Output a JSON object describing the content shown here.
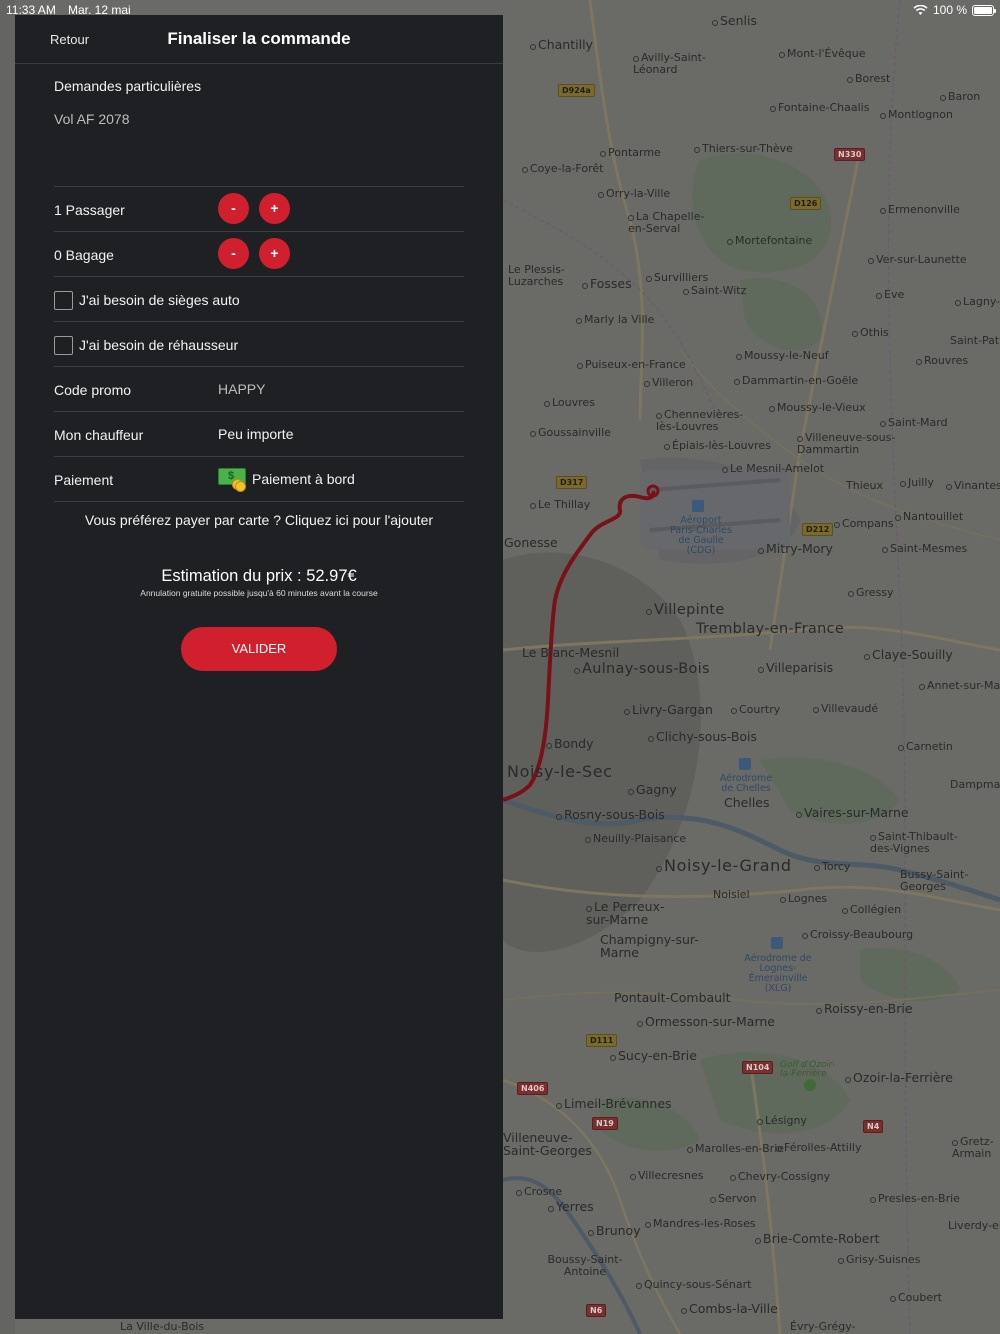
{
  "status_bar": {
    "time": "11:33 AM",
    "date": "Mar. 12 mai",
    "battery": "100 %"
  },
  "nav": {
    "back_label": "Retour",
    "title": "Finaliser la commande"
  },
  "special_requests": {
    "label": "Demandes particulières",
    "value": "Vol AF 2078"
  },
  "passengers": {
    "label": "1 Passager",
    "minus": "-",
    "plus": "+"
  },
  "luggage": {
    "label": "0 Bagage",
    "minus": "-",
    "plus": "+"
  },
  "child_seat": {
    "label": "J'ai besoin de sièges auto",
    "checked": false
  },
  "booster": {
    "label": "J'ai besoin de réhausseur",
    "checked": false
  },
  "promo": {
    "label": "Code promo",
    "value": "HAPPY"
  },
  "driver": {
    "label": "Mon chauffeur",
    "value": "Peu importe"
  },
  "payment": {
    "label": "Paiement",
    "value": "Paiement à bord",
    "icon": "cash-icon"
  },
  "card_link": "Vous préférez payer par carte ? Cliquez ici pour l'ajouter",
  "price": {
    "estimate": "Estimation du prix : 52.97€",
    "note": "Annulation gratuite possible jusqu'à 60 minutes avant la course"
  },
  "validate_label": "VALIDER",
  "colors": {
    "accent": "#d0202d",
    "panel": "#1f2023",
    "route": "#7a1018"
  },
  "map": {
    "places": [
      "Senlis",
      "Mont-l'Évêque",
      "Chantilly",
      "Avilly-Saint-Léonard",
      "Borest",
      "Baron",
      "Fontaine-Chaalis",
      "Montlognon",
      "Pontarme",
      "Thiers-sur-Thève",
      "Coye-la-Forêt",
      "Orry-la-Ville",
      "Ermenonville",
      "La Chapelle-en-Serval",
      "Mortefontaine",
      "Ver-sur-Launette",
      "Le Plessis-Luzarches",
      "Fosses",
      "Survilliers",
      "Saint-Witz",
      "Eve",
      "Lagny-",
      "Marly la Ville",
      "Othis",
      "Saint-Pat",
      "Moussy-le-Neuf",
      "Rouvres",
      "Puiseux-en-France",
      "Villeron",
      "Dammartin-en-Goële",
      "Louvres",
      "Moussy-le-Vieux",
      "Chennevières-lès-Louvres",
      "Saint-Mard",
      "Goussainville",
      "Épiais-lès-Louvres",
      "Villeneuve-sous-Dammartin",
      "Le Mesnil-Amelot",
      "Thieux",
      "Juilly",
      "Vinantes",
      "Le Thillay",
      "Nantouillet",
      "Aéroport Paris-Charles de Gaulle (CDG)",
      "Compans",
      "Gonesse",
      "Mitry-Mory",
      "Saint-Mesmes",
      "Gressy",
      "Villepinte",
      "Tremblay-en-France",
      "Claye-Souilly",
      "Le Blanc-Mesnil",
      "Aulnay-sous-Bois",
      "Villeparisis",
      "Annet-sur-Ma",
      "Livry-Gargan",
      "Courtry",
      "Villevaudé",
      "Bondy",
      "Clichy-sous-Bois",
      "Carnetin",
      "Noisy-le-Sec",
      "Aérodrome de Chelles",
      "Gagny",
      "Chelles",
      "Vaires-sur-Marne",
      "Dampma",
      "Rosny-sous-Bois",
      "Neuilly-Plaisance",
      "Saint-Thibault-des-Vignes",
      "Noisy-le-Grand",
      "Torcy",
      "Bussy-Saint-Georges",
      "Noisiel",
      "Lognes",
      "Collégien",
      "Le Perreux-sur-Marne",
      "Champigny-sur-Marne",
      "Croissy-Beaubourg",
      "Aérodrome de Lognes-Émerainville (XLG)",
      "Pontault-Combault",
      "Roissy-en-Brie",
      "Ormesson-sur-Marne",
      "Sucy-en-Brie",
      "Golf d'Ozoir-la-Ferrière",
      "Ozoir-la-Ferrière",
      "Limeil-Brévannes",
      "Lésigny",
      "Marolles-en-Brie",
      "Férolles-Attilly",
      "Gretz-Armain",
      "Villecresnes",
      "Chevry-Cossigny",
      "Servon",
      "Presles-en-Brie",
      "Crosne",
      "Yerres",
      "Liverdy-en-Bri",
      "Brunoy",
      "Mandres-les-Roses",
      "Brie-Comte-Robert",
      "Grisy-Suisnes",
      "Boussy-Saint-Antoine",
      "Quincy-sous-Sénart",
      "Coubert",
      "Combs-la-Ville",
      "Évry-Grégy-",
      "La Ville-du-Bois",
      "Villeneuve-Saint-Georges"
    ],
    "roads": [
      "D924a",
      "N330",
      "D126",
      "D317",
      "D212",
      "D111",
      "N104",
      "N406",
      "N19",
      "N4",
      "N6"
    ]
  }
}
